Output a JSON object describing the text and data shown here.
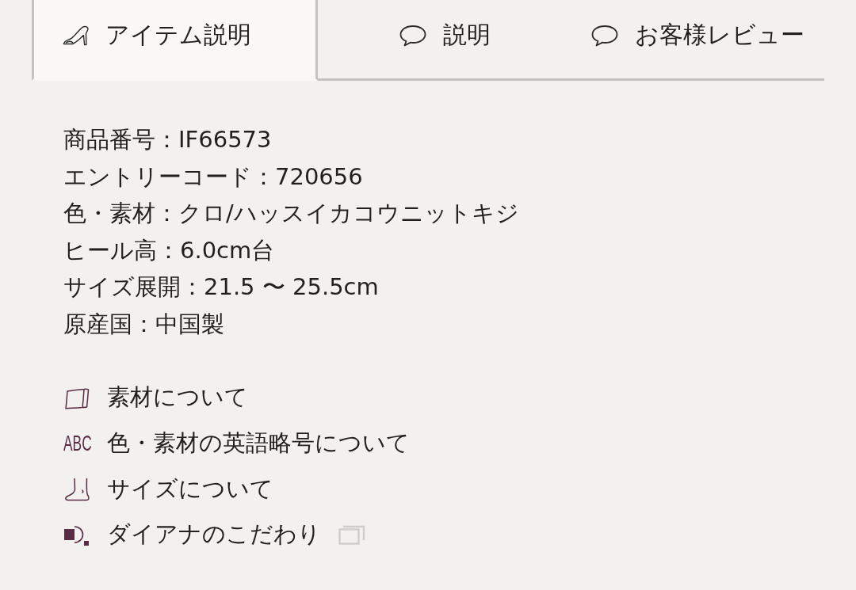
{
  "tabs": [
    {
      "kind": "shoe",
      "label": "アイテム説明",
      "selected": true
    },
    {
      "kind": "speech",
      "label": "説明",
      "selected": false
    },
    {
      "kind": "speech",
      "label": "お客様レビュー",
      "selected": false
    }
  ],
  "specs": [
    "商品番号：IF66573",
    "エントリーコード：720656",
    "色・素材：クロ/ハッスイカコウニットキジ",
    "ヒール高：6.0cm台",
    "サイズ展開：21.5 〜 25.5cm",
    "原産国：中国製"
  ],
  "links": [
    {
      "kind": "material",
      "label": "素材について",
      "external": false
    },
    {
      "kind": "abbreviation",
      "icon_text": "ABC",
      "label": "色・素材の英語略号について",
      "external": false
    },
    {
      "kind": "size",
      "label": "サイズについて",
      "external": false
    },
    {
      "kind": "commitment",
      "label": "ダイアナのこだわり",
      "external": true
    }
  ]
}
